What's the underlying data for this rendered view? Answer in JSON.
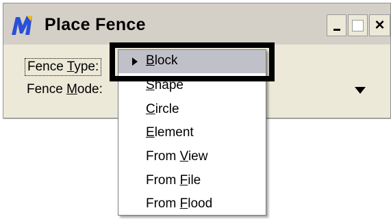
{
  "window": {
    "title": "Place Fence",
    "close_glyph": "×",
    "icon": "microstation-logo-icon"
  },
  "fields": {
    "fence_type": {
      "label_pre": "Fence ",
      "label_key": "T",
      "label_post": "ype:"
    },
    "fence_mode": {
      "label_pre": "Fence ",
      "label_key": "M",
      "label_post": "ode:"
    }
  },
  "colors": {
    "logo_blue": "#2a4fd8",
    "selected_bg": "#c0c0c8",
    "dialog_bg": "#ece9d8"
  },
  "menu": {
    "items": [
      {
        "key": "B",
        "rest": "lock",
        "prefix": "",
        "selected": true
      },
      {
        "key": "S",
        "rest": "hape",
        "prefix": ""
      },
      {
        "key": "C",
        "rest": "ircle",
        "prefix": ""
      },
      {
        "key": "E",
        "rest": "lement",
        "prefix": ""
      },
      {
        "key": "V",
        "rest": "iew",
        "prefix": "From "
      },
      {
        "key": "F",
        "rest": "ile",
        "prefix": "From "
      },
      {
        "key": "F",
        "rest": "lood",
        "prefix": "From "
      }
    ]
  }
}
